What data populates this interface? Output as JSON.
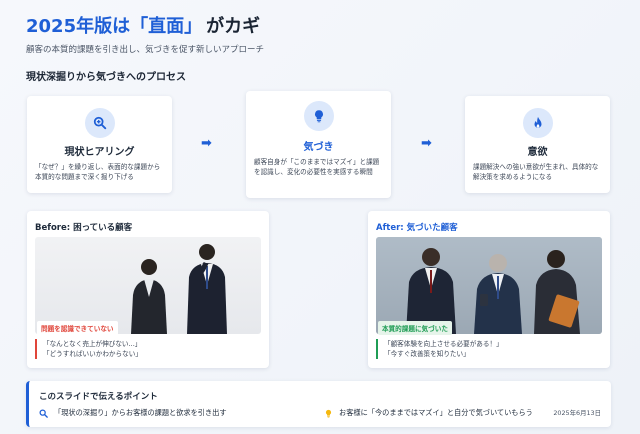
{
  "header": {
    "title_highlight": "2025年版は「直面」",
    "title_rest": "がカギ",
    "subtitle": "顧客の本質的課題を引き出し、気づきを促す新しいアプローチ"
  },
  "process": {
    "section_title": "現状深掘りから気づきへのプロセス",
    "steps": [
      {
        "icon": "magnify-plus-icon",
        "title": "現状ヒアリング",
        "desc": "「なぜ？」を繰り返し、表面的な課題から本質的な問題まで深く掘り下げる"
      },
      {
        "icon": "lightbulb-icon",
        "title": "気づき",
        "desc": "顧客自身が「このままではマズイ」と課題を認識し、変化の必要性を実感する瞬間"
      },
      {
        "icon": "flame-icon",
        "title": "意欲",
        "desc": "課題解決への強い意欲が生まれ、具体的な解決策を求めるようになる"
      }
    ],
    "arrow": "➡"
  },
  "before": {
    "title": "Before: 困っている顧客",
    "tag": "問題を認識できていない",
    "quote_lines": [
      "「なんとなく売上が伸びない...」",
      "「どうすればいいかわからない」"
    ]
  },
  "after": {
    "title": "After: 気づいた顧客",
    "tag": "本質的課題に気づいた",
    "quote_lines": [
      "「顧客体験を向上させる必要がある！」",
      "「今すぐ改善策を知りたい」"
    ]
  },
  "points": {
    "title": "このスライドで伝えるポイント",
    "items": [
      {
        "icon": "search-icon",
        "text": "「現状の深掘り」からお客様の課題と欲求を引き出す"
      },
      {
        "icon": "lightbulb-icon",
        "text": "お客様に「今のままではマズイ」と自分で気づいていもらう"
      }
    ],
    "date": "2025年6月13日"
  },
  "colors": {
    "accent": "#1f5fd6",
    "before_red": "#e0453a",
    "after_green": "#1f9d55"
  }
}
